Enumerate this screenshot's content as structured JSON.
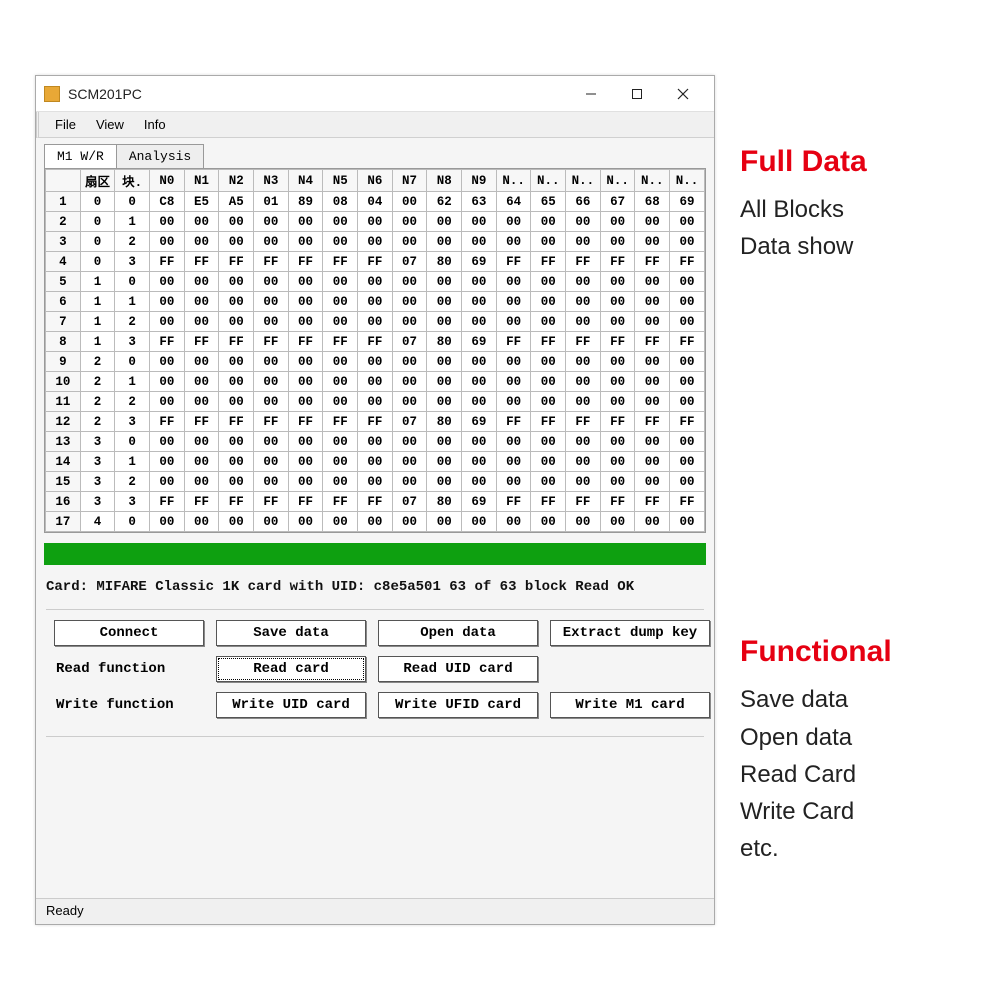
{
  "window": {
    "title": "SCM201PC"
  },
  "menubar": [
    "File",
    "View",
    "Info"
  ],
  "tabs": {
    "active": "M1 W/R",
    "inactive": "Analysis"
  },
  "grid": {
    "headers": [
      "",
      "扇区",
      "块.",
      "N0",
      "N1",
      "N2",
      "N3",
      "N4",
      "N5",
      "N6",
      "N7",
      "N8",
      "N9",
      "N..",
      "N..",
      "N..",
      "N..",
      "N..",
      "N.."
    ],
    "rows": [
      [
        "1",
        "0",
        "0",
        "C8",
        "E5",
        "A5",
        "01",
        "89",
        "08",
        "04",
        "00",
        "62",
        "63",
        "64",
        "65",
        "66",
        "67",
        "68",
        "69"
      ],
      [
        "2",
        "0",
        "1",
        "00",
        "00",
        "00",
        "00",
        "00",
        "00",
        "00",
        "00",
        "00",
        "00",
        "00",
        "00",
        "00",
        "00",
        "00",
        "00"
      ],
      [
        "3",
        "0",
        "2",
        "00",
        "00",
        "00",
        "00",
        "00",
        "00",
        "00",
        "00",
        "00",
        "00",
        "00",
        "00",
        "00",
        "00",
        "00",
        "00"
      ],
      [
        "4",
        "0",
        "3",
        "FF",
        "FF",
        "FF",
        "FF",
        "FF",
        "FF",
        "FF",
        "07",
        "80",
        "69",
        "FF",
        "FF",
        "FF",
        "FF",
        "FF",
        "FF"
      ],
      [
        "5",
        "1",
        "0",
        "00",
        "00",
        "00",
        "00",
        "00",
        "00",
        "00",
        "00",
        "00",
        "00",
        "00",
        "00",
        "00",
        "00",
        "00",
        "00"
      ],
      [
        "6",
        "1",
        "1",
        "00",
        "00",
        "00",
        "00",
        "00",
        "00",
        "00",
        "00",
        "00",
        "00",
        "00",
        "00",
        "00",
        "00",
        "00",
        "00"
      ],
      [
        "7",
        "1",
        "2",
        "00",
        "00",
        "00",
        "00",
        "00",
        "00",
        "00",
        "00",
        "00",
        "00",
        "00",
        "00",
        "00",
        "00",
        "00",
        "00"
      ],
      [
        "8",
        "1",
        "3",
        "FF",
        "FF",
        "FF",
        "FF",
        "FF",
        "FF",
        "FF",
        "07",
        "80",
        "69",
        "FF",
        "FF",
        "FF",
        "FF",
        "FF",
        "FF"
      ],
      [
        "9",
        "2",
        "0",
        "00",
        "00",
        "00",
        "00",
        "00",
        "00",
        "00",
        "00",
        "00",
        "00",
        "00",
        "00",
        "00",
        "00",
        "00",
        "00"
      ],
      [
        "10",
        "2",
        "1",
        "00",
        "00",
        "00",
        "00",
        "00",
        "00",
        "00",
        "00",
        "00",
        "00",
        "00",
        "00",
        "00",
        "00",
        "00",
        "00"
      ],
      [
        "11",
        "2",
        "2",
        "00",
        "00",
        "00",
        "00",
        "00",
        "00",
        "00",
        "00",
        "00",
        "00",
        "00",
        "00",
        "00",
        "00",
        "00",
        "00"
      ],
      [
        "12",
        "2",
        "3",
        "FF",
        "FF",
        "FF",
        "FF",
        "FF",
        "FF",
        "FF",
        "07",
        "80",
        "69",
        "FF",
        "FF",
        "FF",
        "FF",
        "FF",
        "FF"
      ],
      [
        "13",
        "3",
        "0",
        "00",
        "00",
        "00",
        "00",
        "00",
        "00",
        "00",
        "00",
        "00",
        "00",
        "00",
        "00",
        "00",
        "00",
        "00",
        "00"
      ],
      [
        "14",
        "3",
        "1",
        "00",
        "00",
        "00",
        "00",
        "00",
        "00",
        "00",
        "00",
        "00",
        "00",
        "00",
        "00",
        "00",
        "00",
        "00",
        "00"
      ],
      [
        "15",
        "3",
        "2",
        "00",
        "00",
        "00",
        "00",
        "00",
        "00",
        "00",
        "00",
        "00",
        "00",
        "00",
        "00",
        "00",
        "00",
        "00",
        "00"
      ],
      [
        "16",
        "3",
        "3",
        "FF",
        "FF",
        "FF",
        "FF",
        "FF",
        "FF",
        "FF",
        "07",
        "80",
        "69",
        "FF",
        "FF",
        "FF",
        "FF",
        "FF",
        "FF"
      ],
      [
        "17",
        "4",
        "0",
        "00",
        "00",
        "00",
        "00",
        "00",
        "00",
        "00",
        "00",
        "00",
        "00",
        "00",
        "00",
        "00",
        "00",
        "00",
        "00"
      ]
    ]
  },
  "status_card": "Card: MIFARE Classic 1K card with UID: c8e5a501 63 of 63 block Read OK",
  "buttons": {
    "connect": "Connect",
    "save_data": "Save data",
    "open_data": "Open data",
    "extract_dump_key": "Extract dump key",
    "read_fn_label": "Read function",
    "read_card": "Read card",
    "read_uid_card": "Read UID card",
    "write_fn_label": "Write function",
    "write_uid_card": "Write UID card",
    "write_ufid_card": "Write UFID card",
    "write_m1_card": "Write M1 card"
  },
  "bottom_status": "Ready",
  "annotations": {
    "block1_title": "Full Data",
    "block1_body": "All Blocks\nData show",
    "block2_title": "Functional",
    "block2_body": "Save data\nOpen data\nRead Card\nWrite Card\netc."
  }
}
